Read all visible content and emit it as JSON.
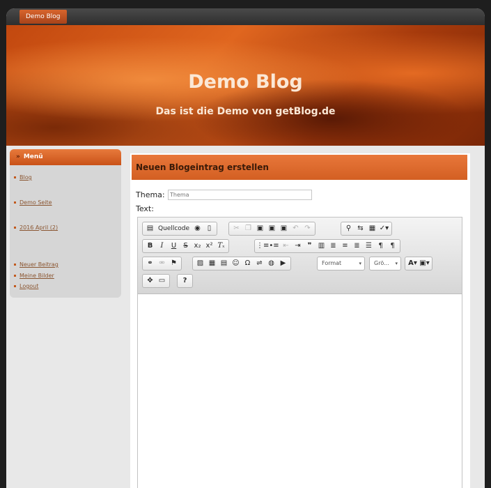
{
  "topbar": {
    "tab_label": "Demo Blog"
  },
  "banner": {
    "title": "Demo Blog",
    "subtitle": "Das ist die Demo von getBlog.de"
  },
  "sidebar": {
    "title": "Menü",
    "items": [
      {
        "label": "Blog"
      },
      {
        "label": "Demo Seite"
      },
      {
        "label": "2016 April (2)"
      },
      {
        "label": "Neuer Beitrag"
      },
      {
        "label": "Meine Bilder"
      },
      {
        "label": "Logout"
      }
    ]
  },
  "main": {
    "heading": "Neuen Blogeintrag erstellen",
    "thema_label": "Thema:",
    "thema_placeholder": "Thema",
    "text_label": "Text:"
  },
  "editor": {
    "source_label": "Quellcode",
    "format_label": "Format",
    "size_label": "Grö...",
    "colors": {
      "accent": "#d9632a",
      "banner": "#c2480f"
    }
  }
}
